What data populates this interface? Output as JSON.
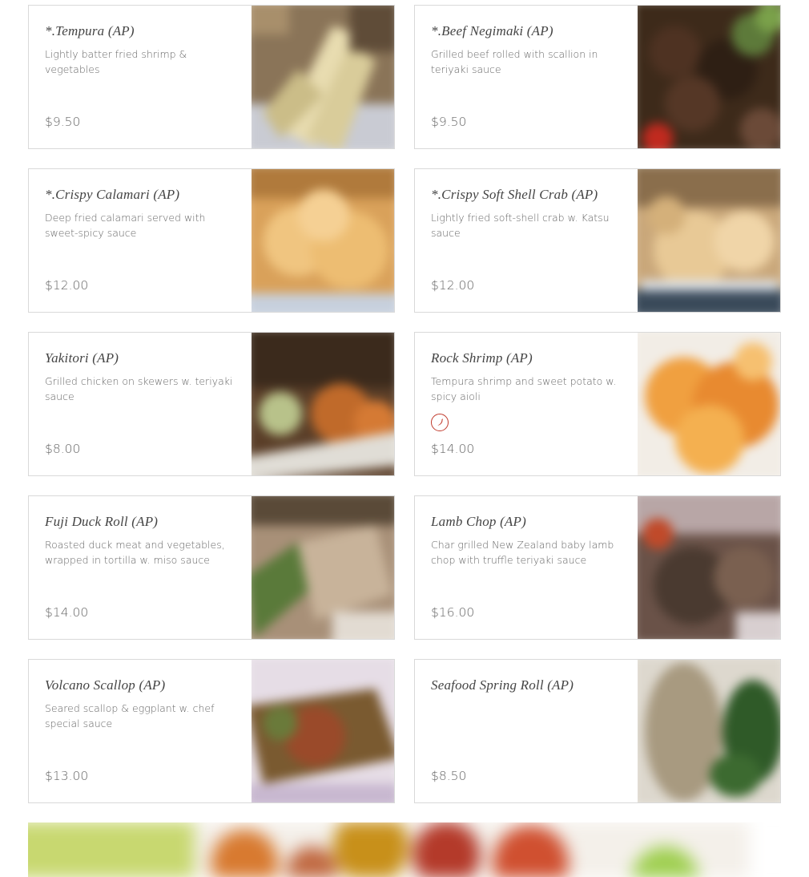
{
  "menu": {
    "items": [
      {
        "title": "*.Tempura (AP)",
        "description": "Lightly batter fried shrimp & vegetables",
        "price": "$9.50",
        "spicy": false
      },
      {
        "title": "*.Beef Negimaki (AP)",
        "description": "Grilled beef rolled with scallion in teriyaki sauce",
        "price": "$9.50",
        "spicy": false
      },
      {
        "title": "*.Crispy Calamari (AP)",
        "description": "Deep fried calamari served with sweet-spicy sauce",
        "price": "$12.00",
        "spicy": false
      },
      {
        "title": "*.Crispy Soft Shell Crab (AP)",
        "description": "Lightly fried soft-shell crab w. Katsu sauce",
        "price": "$12.00",
        "spicy": false
      },
      {
        "title": "Yakitori (AP)",
        "description": "Grilled chicken on skewers w. teriyaki sauce",
        "price": "$8.00",
        "spicy": false
      },
      {
        "title": "Rock Shrimp (AP)",
        "description": "Tempura shrimp and sweet potato w. spicy aioli",
        "price": "$14.00",
        "spicy": true
      },
      {
        "title": "Fuji Duck Roll (AP)",
        "description": "Roasted duck meat and vegetables, wrapped in tortilla w. miso sauce",
        "price": "$14.00",
        "spicy": false
      },
      {
        "title": "Lamb Chop (AP)",
        "description": "Char grilled New Zealand baby lamb chop with truffle teriyaki sauce",
        "price": "$16.00",
        "spicy": false
      },
      {
        "title": "Volcano Scallop (AP)",
        "description": "Seared scallop & eggplant w. chef special sauce",
        "price": "$13.00",
        "spicy": false
      },
      {
        "title": "Seafood Spring Roll (AP)",
        "description": "",
        "price": "$8.50",
        "spicy": false
      }
    ]
  },
  "icons": {
    "spicy": "chili-pepper-icon"
  },
  "colors": {
    "spicy_accent": "#c0392b",
    "card_border": "#d9d9d9"
  }
}
